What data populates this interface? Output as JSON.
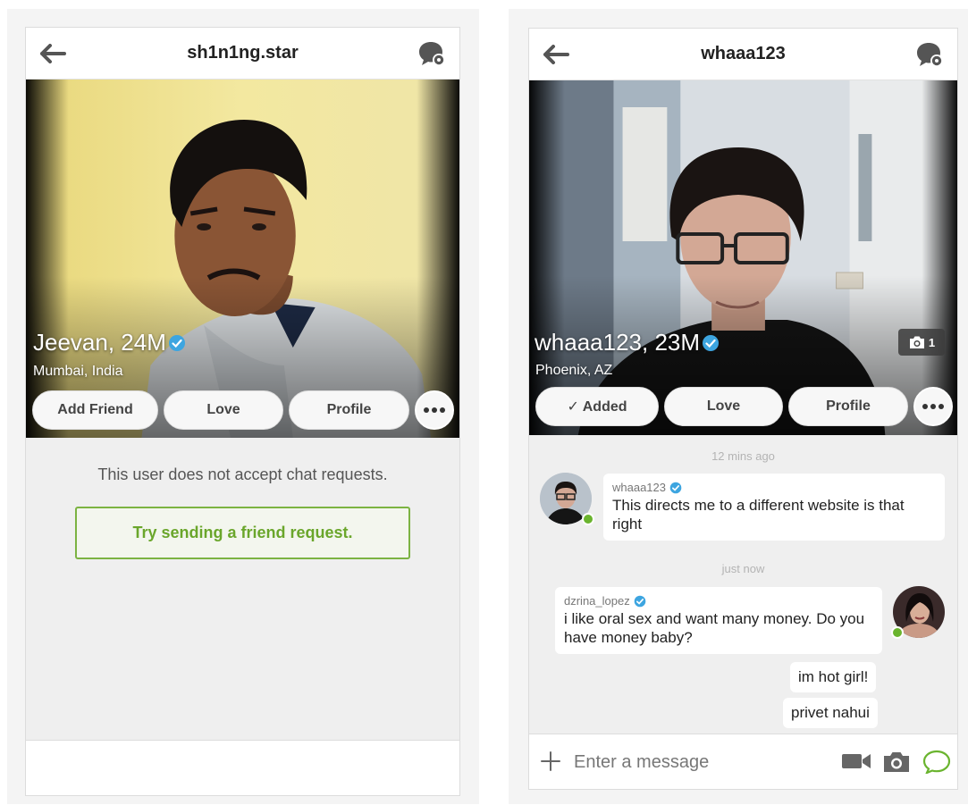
{
  "left": {
    "header_title": "sh1n1ng.star",
    "profile_name": "Jeevan, 24M",
    "location": "Mumbai, India",
    "buttons": {
      "add_friend": "Add Friend",
      "love": "Love",
      "profile": "Profile"
    },
    "notice": "This user does not accept chat requests.",
    "try_button": "Try sending a friend request."
  },
  "right": {
    "header_title": "whaaa123",
    "profile_name": "whaaa123, 23M",
    "location": "Phoenix, AZ",
    "photo_count": "1",
    "buttons": {
      "added": "✓ Added",
      "love": "Love",
      "profile": "Profile"
    },
    "messages": {
      "ts1": "12 mins ago",
      "m1_sender": "whaaa123",
      "m1_text": "This directs me to a different website is that right",
      "ts2": "just now",
      "m2_sender": "dzrina_lopez",
      "m2_text": "i like oral sex and want many money. Do you have money baby?",
      "m3_text": "im hot girl!",
      "m4_text": "privet nahui"
    },
    "composer_placeholder": "Enter a message"
  },
  "colors": {
    "accent_green": "#7cb342",
    "verified_blue": "#3da5e0",
    "online_green": "#6ab42e"
  },
  "icons": {
    "back": "arrow-left-icon",
    "settings": "chat-settings-icon",
    "verified": "verified-check-icon",
    "more": "more-dots-icon",
    "camera": "camera-icon",
    "video": "video-camera-icon",
    "chat": "chat-bubble-icon",
    "plus": "plus-icon"
  }
}
